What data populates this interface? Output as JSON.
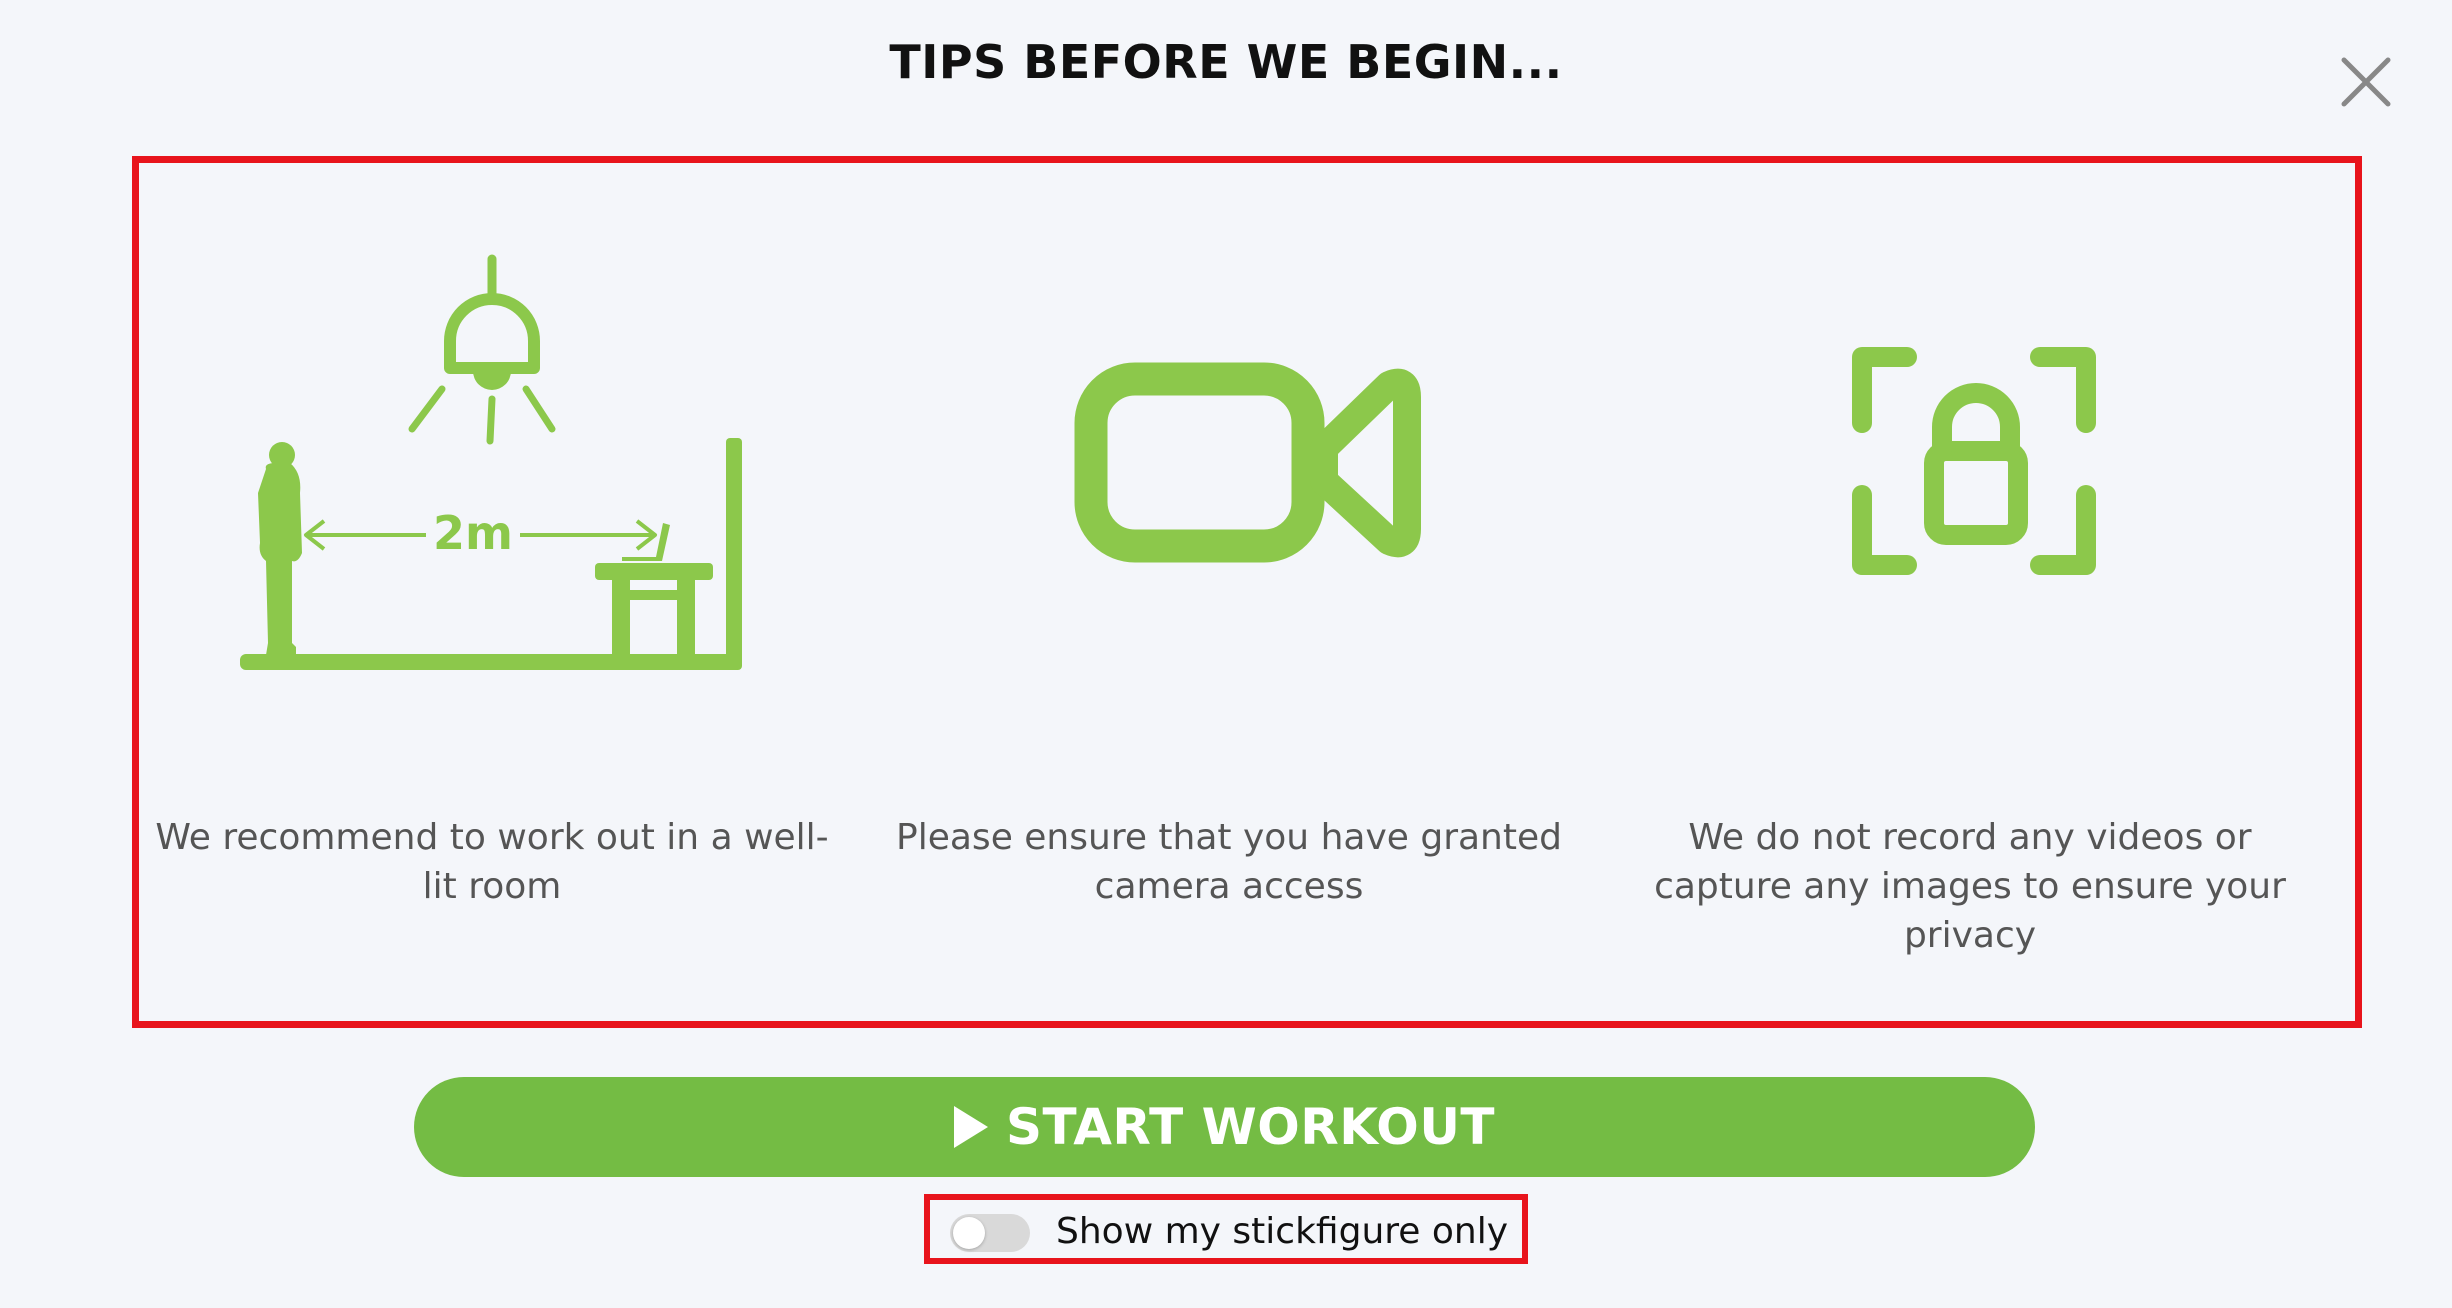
{
  "modal": {
    "title": "TIPS BEFORE WE BEGIN..."
  },
  "tips": [
    {
      "text": "We recommend to work out in a well-lit room",
      "icon": "well-lit-room-icon",
      "distance_label": "2m"
    },
    {
      "text": "Please ensure that you have granted camera access",
      "icon": "video-camera-icon"
    },
    {
      "text": "We do not record any videos or capture any images to ensure your privacy",
      "icon": "privacy-lock-icon"
    }
  ],
  "actions": {
    "start_label": "START WORKOUT",
    "start_icon": "play-icon",
    "close_icon": "close-icon"
  },
  "stickfigure_toggle": {
    "label": "Show my stickfigure only",
    "checked": false
  },
  "colors": {
    "accent_green": "#74bc44",
    "illustration_green": "#8cc84b",
    "highlight_red": "#e8141c",
    "background": "#f4f6fa",
    "body_text": "#555555"
  }
}
